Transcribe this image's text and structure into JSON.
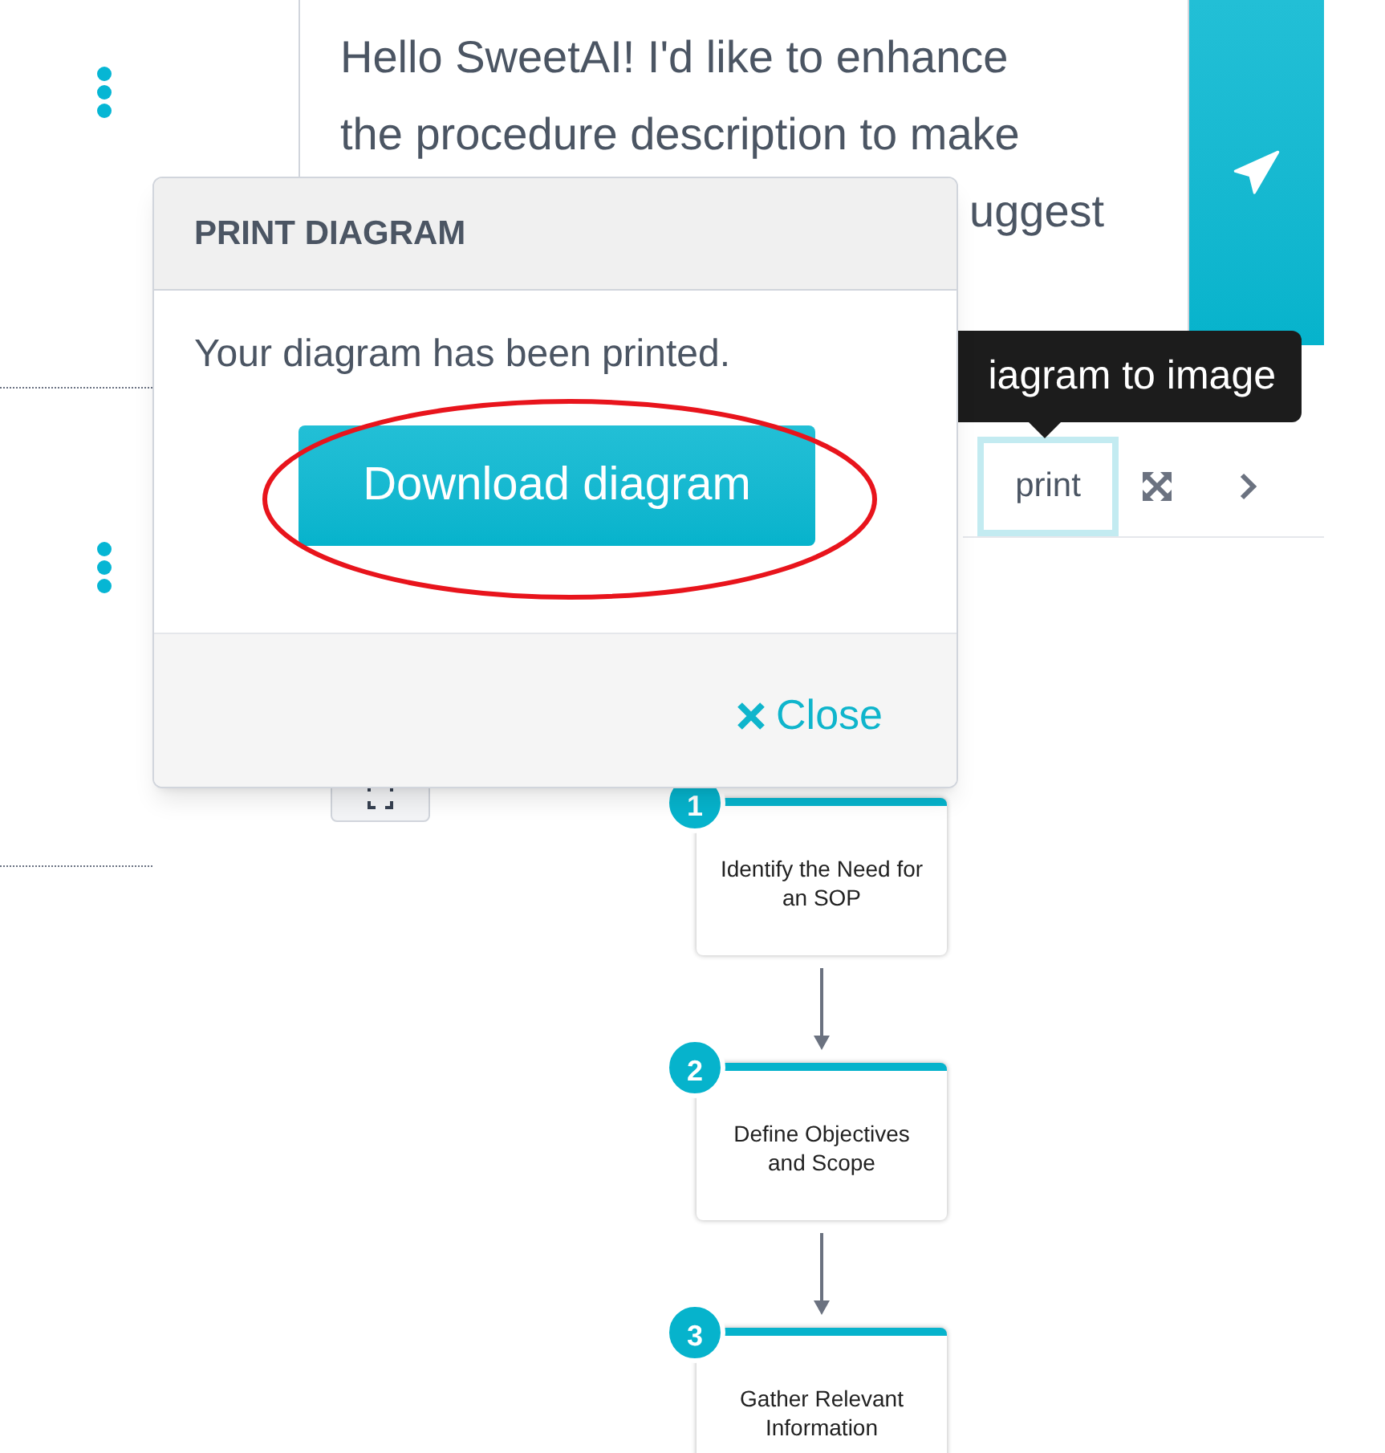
{
  "message_lines": [
    "Hello SweetAI! I'd like to enhance",
    "the procedure description to make",
    "uggest"
  ],
  "tooltip": "iagram to image",
  "toolbar": [
    {
      "kind": "text",
      "label": "print",
      "focused": true
    },
    {
      "kind": "expand",
      "focused": false
    },
    {
      "kind": "next",
      "focused": false
    }
  ],
  "steps": [
    {
      "number": "1",
      "label": "Identify the Need for an SOP"
    },
    {
      "number": "2",
      "label": "Define Objectives and Scope"
    },
    {
      "number": "3",
      "label": "Gather Relevant Information"
    }
  ],
  "modal": {
    "title": "PRINT DIAGRAM",
    "message": "Your diagram has been printed.",
    "primary_button": "Download diagram",
    "close_button": "Close"
  }
}
